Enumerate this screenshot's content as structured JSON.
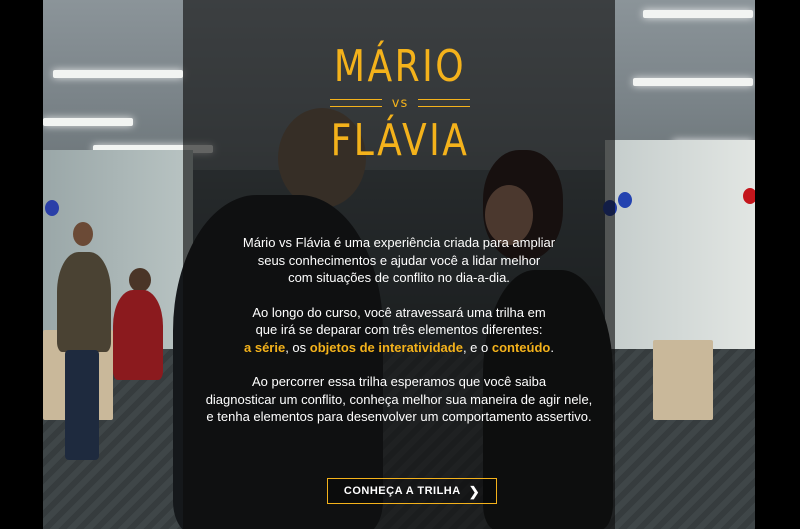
{
  "logo": {
    "line1": "MÁRIO",
    "vs": "vs",
    "line2": "FLÁVIA"
  },
  "intro": {
    "p1": [
      "Mário vs Flávia é uma experiência criada para ampliar",
      "seus conhecimentos e ajudar você a lidar melhor",
      "com situações de conflito no dia-a-dia."
    ],
    "p2": [
      "Ao longo do curso, você atravessará uma trilha em",
      "que irá se deparar com três elementos diferentes:"
    ],
    "p2_elements": {
      "serie": "a série",
      "sep1": ", os ",
      "objetos": "objetos de interatividade",
      "sep2": ", e o ",
      "conteudo": "conteúdo",
      "end": "."
    },
    "p3": [
      "Ao percorrer essa trilha esperamos que você saiba",
      "diagnosticar um conflito, conheça melhor sua maneira de agir nele,",
      "e tenha elementos para desenvolver um comportamento assertivo."
    ]
  },
  "cta": {
    "label": "CONHEÇA A TRILHA",
    "icon": "chevron-right-icon"
  },
  "colors": {
    "accent": "#f4b21b",
    "panel": "rgba(12,12,12,0.62)",
    "text": "#ffffff"
  }
}
